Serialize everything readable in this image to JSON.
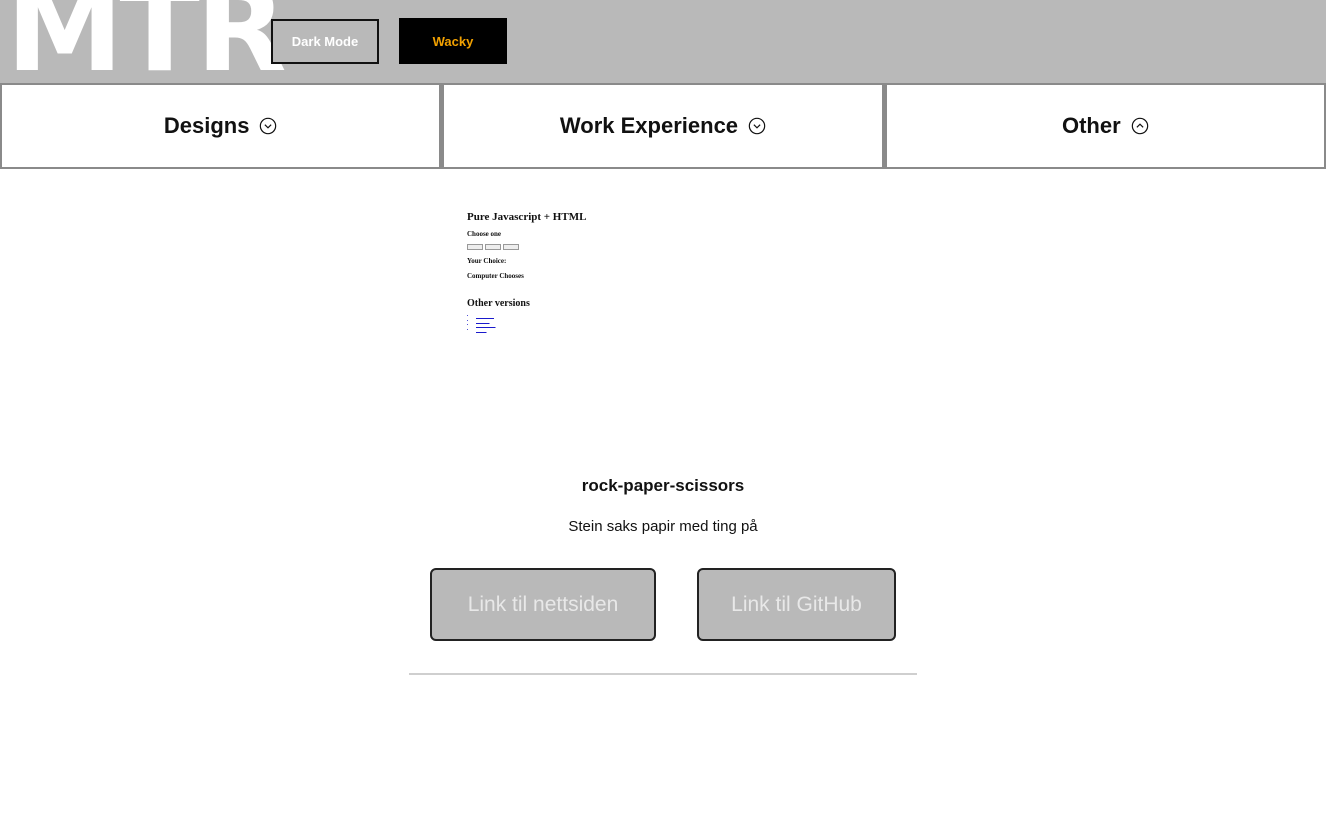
{
  "header": {
    "logo": "MTR",
    "dark_mode_label": "Dark Mode",
    "wacky_label": "Wacky",
    "colors": {
      "bar": "#b9b9b9",
      "wacky_bg": "#000000",
      "wacky_text": "#f2a100"
    }
  },
  "nav": {
    "items": [
      {
        "label": "Designs",
        "icon": "chevron-down-circle-icon"
      },
      {
        "label": "Work Experience",
        "icon": "chevron-down-circle-icon"
      },
      {
        "label": "Other",
        "icon": "chevron-up-circle-icon"
      }
    ]
  },
  "project": {
    "preview": {
      "heading": "Pure Javascript + HTML",
      "choose": "Choose one",
      "your_choice": "Your Choice:",
      "computer_chooses": "Computer Chooses",
      "other_versions": "Other versions"
    },
    "title": "rock-paper-scissors",
    "description": "Stein saks papir med ting på",
    "site_link_label": "Link til nettsiden",
    "github_link_label": "Link til GitHub"
  }
}
